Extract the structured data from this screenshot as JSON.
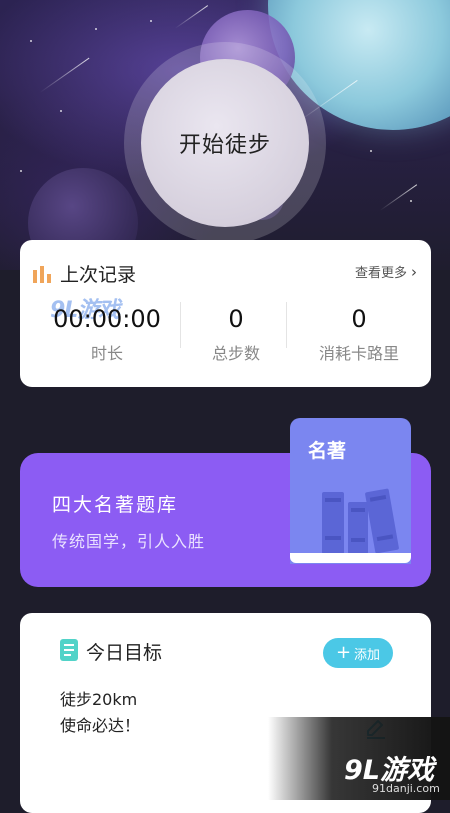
{
  "hero": {
    "start_label": "开始徒步"
  },
  "record": {
    "title": "上次记录",
    "more_label": "查看更多",
    "stats": [
      {
        "value": "00:00:00",
        "label": "时长"
      },
      {
        "value": "0",
        "label": "总步数"
      },
      {
        "value": "0",
        "label": "消耗卡路里"
      }
    ]
  },
  "classics": {
    "title": "四大名著题库",
    "subtitle": "传统国学，引人入胜",
    "book_label": "名著"
  },
  "goal": {
    "title": "今日目标",
    "add_label": "添加",
    "lines": [
      "徒步20km",
      "使命必达！"
    ]
  },
  "watermark": {
    "brand": "9L游戏",
    "domain": "91danji.com",
    "card_logo": "9L游戏"
  },
  "colors": {
    "accent_purple": "#8c5cf3",
    "book_blue": "#7b86f0",
    "add_cyan": "#4bc8e6",
    "bar_orange": "#f0a55a",
    "page_bg": "#1e1d2b"
  }
}
